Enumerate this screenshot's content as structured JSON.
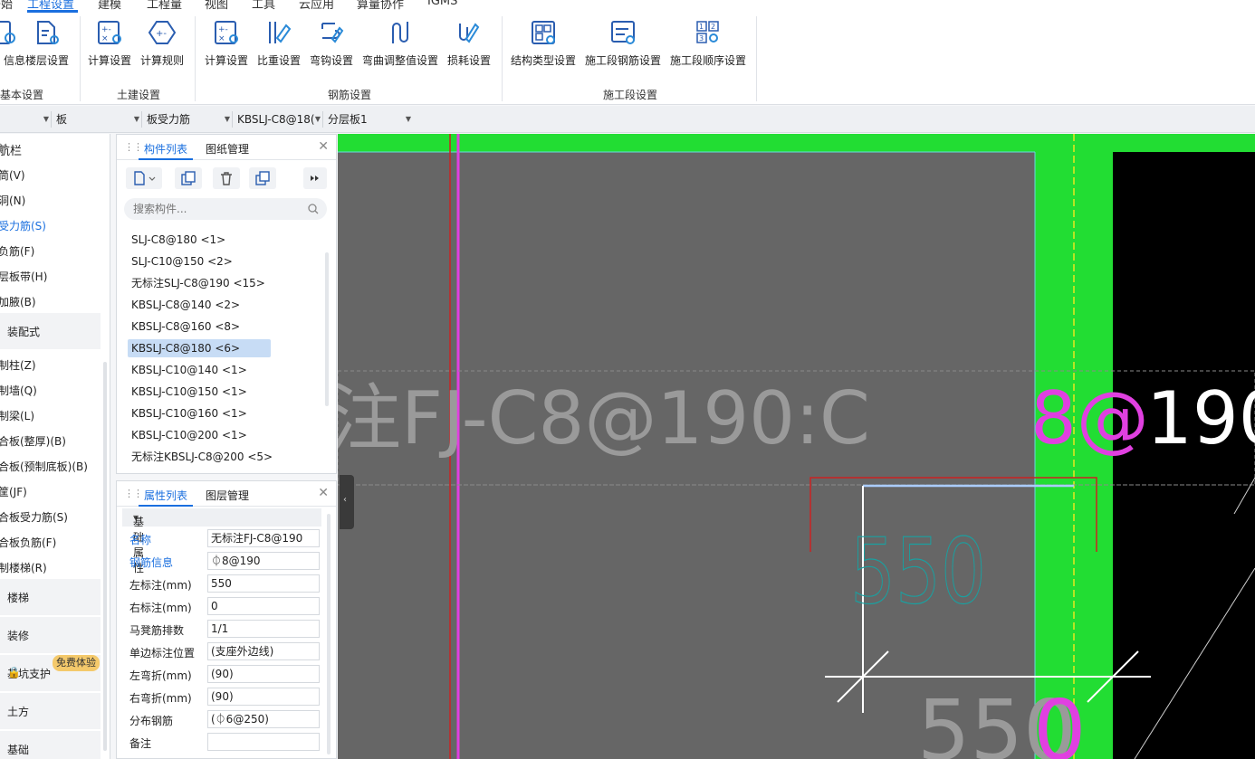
{
  "menu": {
    "items": [
      "开始",
      "工程设置",
      "建模",
      "工程量",
      "视图",
      "工具",
      "云应用",
      "算量协作",
      "IGMS"
    ],
    "active": "工程设置"
  },
  "ribbon": {
    "groups": [
      {
        "label": "基本设置",
        "buttons": [
          "工程信息",
          "楼层设置"
        ]
      },
      {
        "label": "土建设置",
        "buttons": [
          "计算设置",
          "计算规则"
        ]
      },
      {
        "label": "钢筋设置",
        "buttons": [
          "计算设置",
          "比重设置",
          "弯钩设置",
          "弯曲调整值设置",
          "损耗设置"
        ]
      },
      {
        "label": "施工段设置",
        "buttons": [
          "结构类型设置",
          "施工段钢筋设置",
          "施工段顺序设置"
        ]
      }
    ],
    "visible_labels": {
      "b0": "信息",
      "b1": "楼层设置",
      "b2": "计算设置",
      "b3": "计算规则",
      "b4": "计算设置",
      "b5": "比重设置",
      "b6": "弯钩设置",
      "b7": "弯曲调整值设置",
      "b8": "损耗设置",
      "b9": "结构类型设置",
      "b10": "施工段钢筋设置",
      "b11": "施工段顺序设置",
      "g0": "基本设置",
      "g1": "土建设置",
      "g2": "钢筋设置",
      "g3": "施工段设置"
    }
  },
  "filters": {
    "f1": "板",
    "f2": "板受力筋",
    "f3": "KBSLJ-C8@18(",
    "f4": "分层板1"
  },
  "leftnav": {
    "title": "导航栏",
    "title_visible": "航栏",
    "items": [
      {
        "label": "筒(V)"
      },
      {
        "label": "洞(N)"
      },
      {
        "label": "受力筋(S)",
        "active": true
      },
      {
        "label": "负筋(F)"
      },
      {
        "label": "层板带(H)"
      },
      {
        "label": "加腋(B)"
      },
      {
        "label": "装配式",
        "group": true
      },
      {
        "label": "制柱(Z)"
      },
      {
        "label": "制墙(Q)"
      },
      {
        "label": "制梁(L)"
      },
      {
        "label": "合板(整厚)(B)"
      },
      {
        "label": "合板(预制底板)(B)"
      },
      {
        "label": "筐(JF)"
      },
      {
        "label": "合板受力筋(S)"
      },
      {
        "label": "合板负筋(F)"
      },
      {
        "label": "制楼梯(R)"
      },
      {
        "label": "楼梯",
        "group": true
      },
      {
        "label": "装修",
        "group": true
      },
      {
        "label": "基坑支护",
        "group": true
      },
      {
        "label": "土方",
        "group": true
      },
      {
        "label": "基础",
        "group": true
      }
    ],
    "badge": "免费体验"
  },
  "component_panel": {
    "tab_active": "构件列表",
    "tab_other": "图纸管理",
    "search_placeholder": "搜索构件...",
    "items": [
      "SLJ-C8@180 <1>",
      "SLJ-C10@150 <2>",
      "无标注SLJ-C8@190 <15>",
      "KBSLJ-C8@140 <2>",
      "KBSLJ-C8@160 <8>",
      "KBSLJ-C8@180 <6>",
      "KBSLJ-C10@140 <1>",
      "KBSLJ-C10@150 <1>",
      "KBSLJ-C10@160 <1>",
      "KBSLJ-C10@200 <1>",
      "无标注KBSLJ-C8@200 <5>"
    ],
    "selected_index": 5
  },
  "property_panel": {
    "tab_active": "属性列表",
    "tab_other": "图层管理",
    "section": "基础属性",
    "rows": [
      {
        "key": "名称",
        "value": "无标注FJ-C8@190",
        "blue": true
      },
      {
        "key": "钢筋信息",
        "value": "⏀8@190",
        "blue": true
      },
      {
        "key": "左标注(mm)",
        "value": "550"
      },
      {
        "key": "右标注(mm)",
        "value": "0"
      },
      {
        "key": "马凳筋排数",
        "value": "1/1"
      },
      {
        "key": "单边标注位置",
        "value": "(支座外边线)"
      },
      {
        "key": "左弯折(mm)",
        "value": "(90)"
      },
      {
        "key": "右弯折(mm)",
        "value": "(90)"
      },
      {
        "key": "分布钢筋",
        "value": "(⏀6@250)"
      },
      {
        "key": "备注",
        "value": ""
      }
    ]
  },
  "canvas": {
    "label_main": "无标注FJ-C8@190:C8@190",
    "label_gray": "注FJ-C8@190:C",
    "label_magenta": "8@",
    "label_white": "190",
    "dim_left": "550",
    "dim_bottom_gray": "550",
    "dim_bottom_magenta": "0",
    "colors": {
      "background": "#666666",
      "slab_green": "#22dd33",
      "black_region": "#000000",
      "magenta": "#e040e0",
      "red": "#cc2222",
      "cyan": "#1aa0a0",
      "yellow": "#e8e820"
    }
  }
}
